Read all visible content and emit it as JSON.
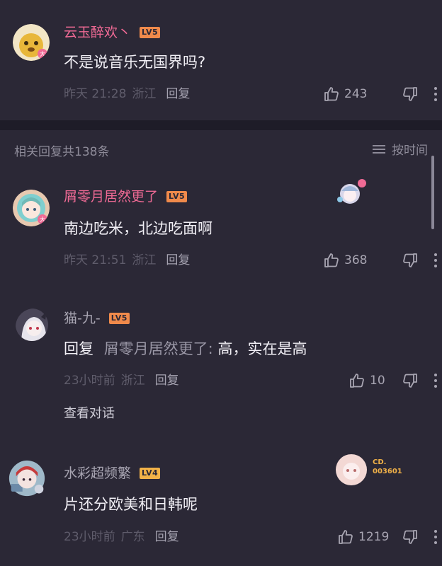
{
  "comments": [
    {
      "username": "云玉醉欢丶",
      "level": "LV5",
      "text": "不是说音乐无国界吗?",
      "time": "昨天 21:28",
      "location": "浙江",
      "reply_label": "回复",
      "likes": "243"
    },
    {
      "username": "屑零月居然更了",
      "level": "LV5",
      "text": "南边吃米，北边吃面啊",
      "time": "昨天 21:51",
      "location": "浙江",
      "reply_label": "回复",
      "likes": "368"
    },
    {
      "username": "猫-九-",
      "level": "LV5",
      "reply_prefix": "回复",
      "mention": "屑零月居然更了:",
      "text": " 高，实在是高",
      "time": "23小时前",
      "location": "浙江",
      "reply_label": "回复",
      "likes": "10",
      "view_conversation": "查看对话"
    },
    {
      "username": "水彩超频繁",
      "level": "LV4",
      "text": "片还分欧美和日韩呢",
      "time": "23小时前",
      "location": "广东",
      "reply_label": "回复",
      "likes": "1219",
      "badge_text_1": "CD.",
      "badge_text_2": "003601"
    }
  ],
  "section": {
    "count_label": "相关回复共138条",
    "sort_label": "按时间"
  },
  "icons": {
    "like": "thumbs-up-icon",
    "dislike": "thumbs-down-icon",
    "more": "more-vertical-icon",
    "sort": "list-sort-icon"
  },
  "colors": {
    "card": "#2b2836",
    "background": "#1e1c28",
    "username_pink": "#f06a95",
    "level_orange": "#f08a4b"
  }
}
